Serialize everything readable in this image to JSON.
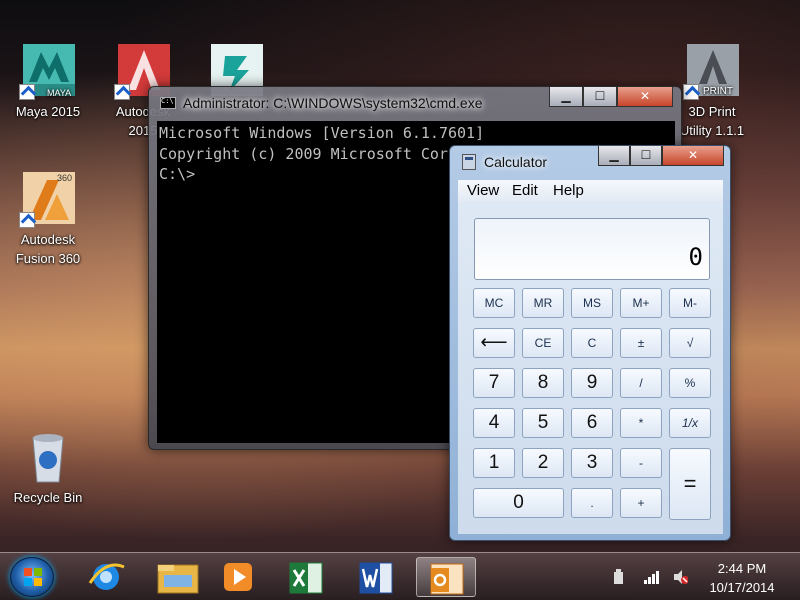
{
  "desktop": {
    "icons": [
      {
        "label": "Maya 2015",
        "badge": "MAYA"
      },
      {
        "label": "Autodesk\n2015"
      },
      {
        "label": ""
      },
      {
        "label": "Autodesk\nFusion 360",
        "badge": "360"
      },
      {
        "label": "Recycle Bin"
      },
      {
        "label": "3D Print\nUtility 1.1.1",
        "badge": "PRINT"
      }
    ]
  },
  "cmd": {
    "title": "Administrator: C:\\WINDOWS\\system32\\cmd.exe",
    "lines": [
      "Microsoft Windows [Version 6.1.7601]",
      "Copyright (c) 2009 Microsoft Corporation.  All rights reserved.",
      "",
      "C:\\>"
    ],
    "minimize": "▁",
    "maximize": "☐",
    "close": "✕"
  },
  "calculator": {
    "title": "Calculator",
    "menu": [
      "View",
      "Edit",
      "Help"
    ],
    "display": "0",
    "buttons": {
      "mc": "MC",
      "mr": "MR",
      "ms": "MS",
      "mplus": "M+",
      "mminus": "M-",
      "back": "⟵",
      "ce": "CE",
      "c": "C",
      "plusminus": "±",
      "sqrt": "√",
      "n7": "7",
      "n8": "8",
      "n9": "9",
      "divide": "/",
      "percent": "%",
      "n4": "4",
      "n5": "5",
      "n6": "6",
      "multiply": "*",
      "recip": "1/x",
      "n1": "1",
      "n2": "2",
      "n3": "3",
      "minus": "-",
      "equals": "=",
      "n0": "0",
      "dot": ".",
      "plus": "+"
    },
    "minimize": "▁",
    "maximize": "☐",
    "close": "✕"
  },
  "taskbar": {
    "apps": [
      {
        "name": "internet-explorer-icon",
        "color": "#1e88e5"
      },
      {
        "name": "file-explorer-icon",
        "color": "#e8b547"
      },
      {
        "name": "media-player-icon",
        "color": "#f28c28"
      },
      {
        "name": "excel-icon",
        "color": "#1d7a3a"
      },
      {
        "name": "word-icon",
        "color": "#1e4fa3"
      },
      {
        "name": "outlook-icon",
        "color": "#e58a1f"
      }
    ],
    "time": "2:44 PM",
    "date": "10/17/2014"
  }
}
